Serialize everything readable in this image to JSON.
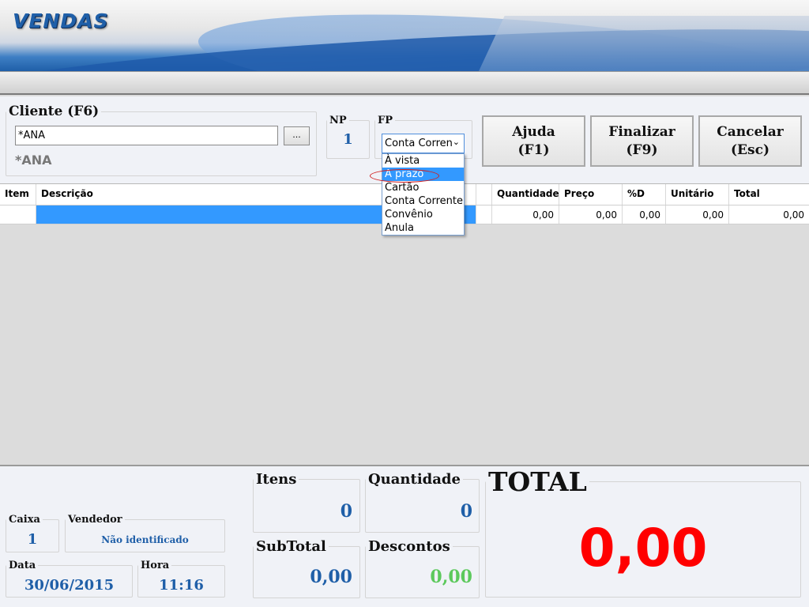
{
  "header": {
    "title": "VENDAS"
  },
  "cliente": {
    "legend": "Cliente (F6)",
    "input_value": "*ANA",
    "lookup_button": "...",
    "name": "*ANA"
  },
  "np": {
    "legend": "NP",
    "value": "1"
  },
  "fp": {
    "legend": "FP",
    "selected": "Conta Corren",
    "options": [
      "À vista",
      "A prazo",
      "Cartão",
      "Conta Corrente",
      "Convênio",
      "Anula"
    ],
    "highlighted_option": "A prazo"
  },
  "buttons": {
    "ajuda": {
      "line1": "Ajuda",
      "line2": "(F1)"
    },
    "finalizar": {
      "line1": "Finalizar",
      "line2": "(F9)"
    },
    "cancelar": {
      "line1": "Cancelar",
      "line2": "(Esc)"
    }
  },
  "grid": {
    "headers": [
      "Item",
      "Descrição",
      "",
      "Quantidade",
      "Preço",
      "%D",
      "Unitário",
      "Total"
    ],
    "row": [
      "",
      "",
      "",
      "0,00",
      "0,00",
      "0,00",
      "0,00",
      "0,00"
    ]
  },
  "footer": {
    "caixa": {
      "label": "Caixa",
      "value": "1"
    },
    "vendedor": {
      "label": "Vendedor",
      "value": "Não identificado"
    },
    "data": {
      "label": "Data",
      "value": "30/06/2015"
    },
    "hora": {
      "label": "Hora",
      "value": "11:16"
    },
    "itens": {
      "label": "Itens",
      "value": "0"
    },
    "quantidade": {
      "label": "Quantidade",
      "value": "0"
    },
    "subtotal": {
      "label": "SubTotal",
      "value": "0,00"
    },
    "descontos": {
      "label": "Descontos",
      "value": "0,00"
    },
    "total": {
      "label": "TOTAL",
      "value": "0,00"
    }
  },
  "colors": {
    "accent_blue": "#1f5fa8",
    "selection": "#3399ff",
    "total_red": "#ff0000",
    "discount_green": "#5cc95c"
  }
}
